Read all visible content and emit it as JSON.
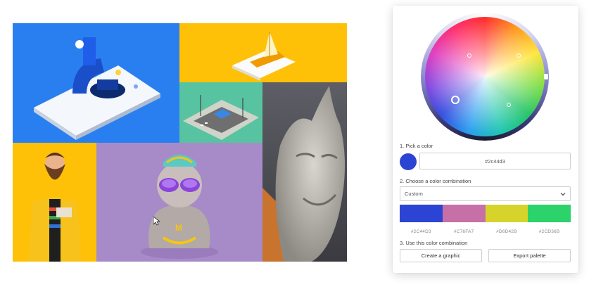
{
  "colors": {
    "blue_tile": "#2a7ff0",
    "yellow_tile": "#ffc107",
    "teal_tile": "#58c3a0",
    "gray_tile": "#4a4a52",
    "purple_tile": "#a78bc8",
    "selected": "#2c44d3",
    "palette": [
      "#2C44D3",
      "#C76FA7",
      "#D6D42B",
      "#2CD36B"
    ]
  },
  "panel": {
    "step1_label": "1. Pick a color",
    "hex_value": "#2c44d3",
    "step2_label": "2. Choose a color combination",
    "combination_selected": "Custom",
    "palette_codes": [
      "#2C44D3",
      "#C76FA7",
      "#D6D42B",
      "#2CD36B"
    ],
    "step3_label": "3. Use this color combination",
    "create_graphic_label": "Create a graphic",
    "export_palette_label": "Export palette"
  },
  "icons": {
    "select_arrow": "chevron-down-icon",
    "cursor": "mouse-cursor-icon"
  }
}
